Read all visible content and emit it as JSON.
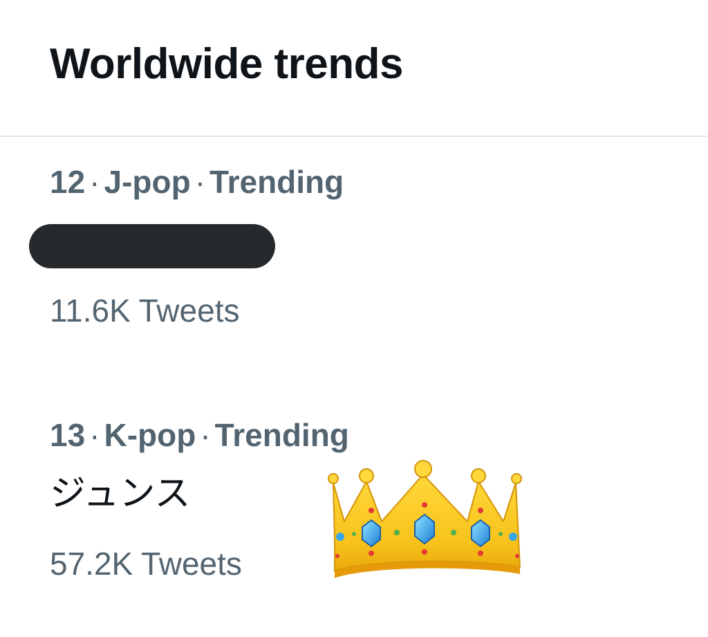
{
  "header": {
    "title": "Worldwide trends"
  },
  "trends": [
    {
      "rank": "12",
      "category": "J-pop",
      "status": "Trending",
      "name": "",
      "name_redacted": true,
      "tweet_count": "11.6K Tweets"
    },
    {
      "rank": "13",
      "category": "K-pop",
      "status": "Trending",
      "name": "ジュンス",
      "name_redacted": false,
      "tweet_count": "57.2K Tweets"
    }
  ],
  "decorations": {
    "emoji": "crown-emoji"
  },
  "colors": {
    "primary_text": "#0f1419",
    "secondary_text": "#536471",
    "divider": "#e3e6e8",
    "redaction": "#262a2d"
  }
}
